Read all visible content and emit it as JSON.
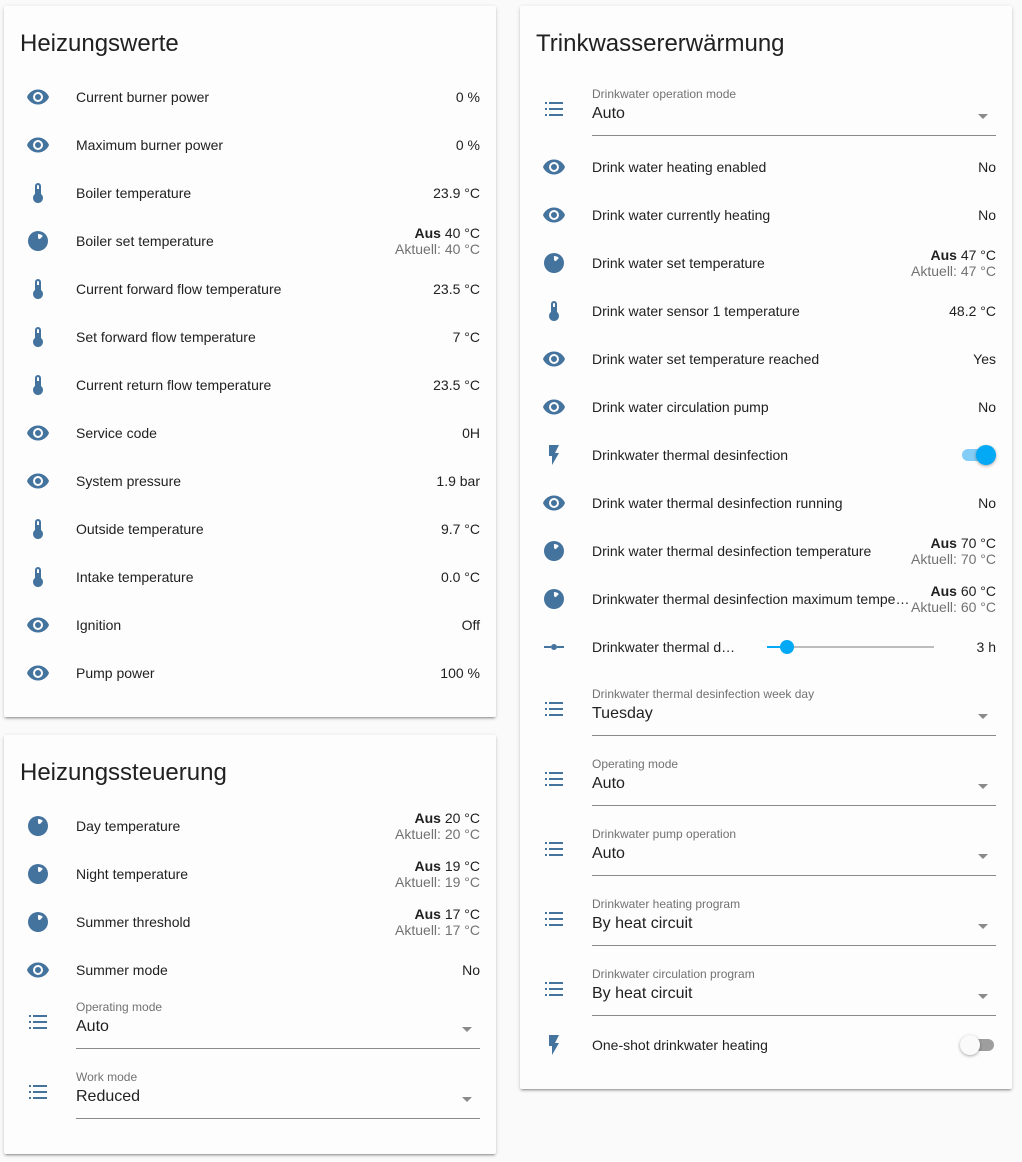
{
  "heizungswerte": {
    "title": "Heizungswerte",
    "rows": [
      {
        "icon": "eye-icon",
        "name": "Current burner power",
        "value": "0 %"
      },
      {
        "icon": "eye-icon",
        "name": "Maximum burner power",
        "value": "0 %"
      },
      {
        "icon": "thermometer-icon",
        "name": "Boiler temperature",
        "value": "23.9 °C"
      },
      {
        "icon": "thermostat-icon",
        "name": "Boiler set temperature",
        "aus": "Aus",
        "set": "40 °C",
        "current": "Aktuell: 40 °C"
      },
      {
        "icon": "thermometer-icon",
        "name": "Current forward flow temperature",
        "value": "23.5 °C"
      },
      {
        "icon": "thermometer-icon",
        "name": "Set forward flow temperature",
        "value": "7 °C"
      },
      {
        "icon": "thermometer-icon",
        "name": "Current return flow temperature",
        "value": "23.5 °C"
      },
      {
        "icon": "eye-icon",
        "name": "Service code",
        "value": "0H"
      },
      {
        "icon": "eye-icon",
        "name": "System pressure",
        "value": "1.9 bar"
      },
      {
        "icon": "thermometer-icon",
        "name": "Outside temperature",
        "value": "9.7 °C"
      },
      {
        "icon": "thermometer-icon",
        "name": "Intake temperature",
        "value": "0.0 °C"
      },
      {
        "icon": "eye-icon",
        "name": "Ignition",
        "value": "Off"
      },
      {
        "icon": "eye-icon",
        "name": "Pump power",
        "value": "100 %"
      }
    ]
  },
  "heizungssteuerung": {
    "title": "Heizungssteuerung",
    "rows": [
      {
        "icon": "thermostat-icon",
        "name": "Day temperature",
        "aus": "Aus",
        "set": "20 °C",
        "current": "Aktuell: 20 °C"
      },
      {
        "icon": "thermostat-icon",
        "name": "Night temperature",
        "aus": "Aus",
        "set": "19 °C",
        "current": "Aktuell: 19 °C"
      },
      {
        "icon": "thermostat-icon",
        "name": "Summer threshold",
        "aus": "Aus",
        "set": "17 °C",
        "current": "Aktuell: 17 °C"
      },
      {
        "icon": "eye-icon",
        "name": "Summer mode",
        "value": "No"
      }
    ],
    "selects": [
      {
        "icon": "list-icon",
        "label": "Operating mode",
        "value": "Auto"
      },
      {
        "icon": "list-icon",
        "label": "Work mode",
        "value": "Reduced"
      }
    ]
  },
  "trinkwasser": {
    "title": "Trinkwassererwärmung",
    "select_top": {
      "icon": "list-icon",
      "label": "Drinkwater operation mode",
      "value": "Auto"
    },
    "rows": [
      {
        "icon": "eye-icon",
        "name": "Drink water heating enabled",
        "value": "No"
      },
      {
        "icon": "eye-icon",
        "name": "Drink water currently heating",
        "value": "No"
      },
      {
        "icon": "thermostat-icon",
        "name": "Drink water set temperature",
        "aus": "Aus",
        "set": "47 °C",
        "current": "Aktuell: 47 °C"
      },
      {
        "icon": "thermometer-icon",
        "name": "Drink water sensor 1 temperature",
        "value": "48.2 °C"
      },
      {
        "icon": "eye-icon",
        "name": "Drink water set temperature reached",
        "value": "Yes"
      },
      {
        "icon": "eye-icon",
        "name": "Drink water circulation pump",
        "value": "No"
      },
      {
        "icon": "flash-icon",
        "name": "Drinkwater thermal desinfection",
        "toggle": true
      },
      {
        "icon": "eye-icon",
        "name": "Drink water thermal desinfection running",
        "value": "No"
      },
      {
        "icon": "thermostat-icon",
        "name": "Drink water thermal desinfection temperature",
        "aus": "Aus",
        "set": "70 °C",
        "current": "Aktuell: 70 °C"
      },
      {
        "icon": "thermostat-icon",
        "name": "Drinkwater thermal desinfection maximum tempe…",
        "aus": "Aus",
        "set": "60 °C",
        "current": "Aktuell: 60 °C"
      },
      {
        "icon": "slider-icon",
        "name": "Drinkwater thermal de…",
        "slider_fraction": 0.12,
        "value": "3 h"
      }
    ],
    "selects": [
      {
        "icon": "list-icon",
        "label": "Drinkwater thermal desinfection week day",
        "value": "Tuesday"
      },
      {
        "icon": "list-icon",
        "label": "Operating mode",
        "value": "Auto"
      },
      {
        "icon": "list-icon",
        "label": "Drinkwater pump operation",
        "value": "Auto"
      },
      {
        "icon": "list-icon",
        "label": "Drinkwater heating program",
        "value": "By heat circuit"
      },
      {
        "icon": "list-icon",
        "label": "Drinkwater circulation program",
        "value": "By heat circuit"
      }
    ],
    "last_row": {
      "icon": "flash-icon",
      "name": "One-shot drinkwater heating",
      "toggle": false
    }
  }
}
